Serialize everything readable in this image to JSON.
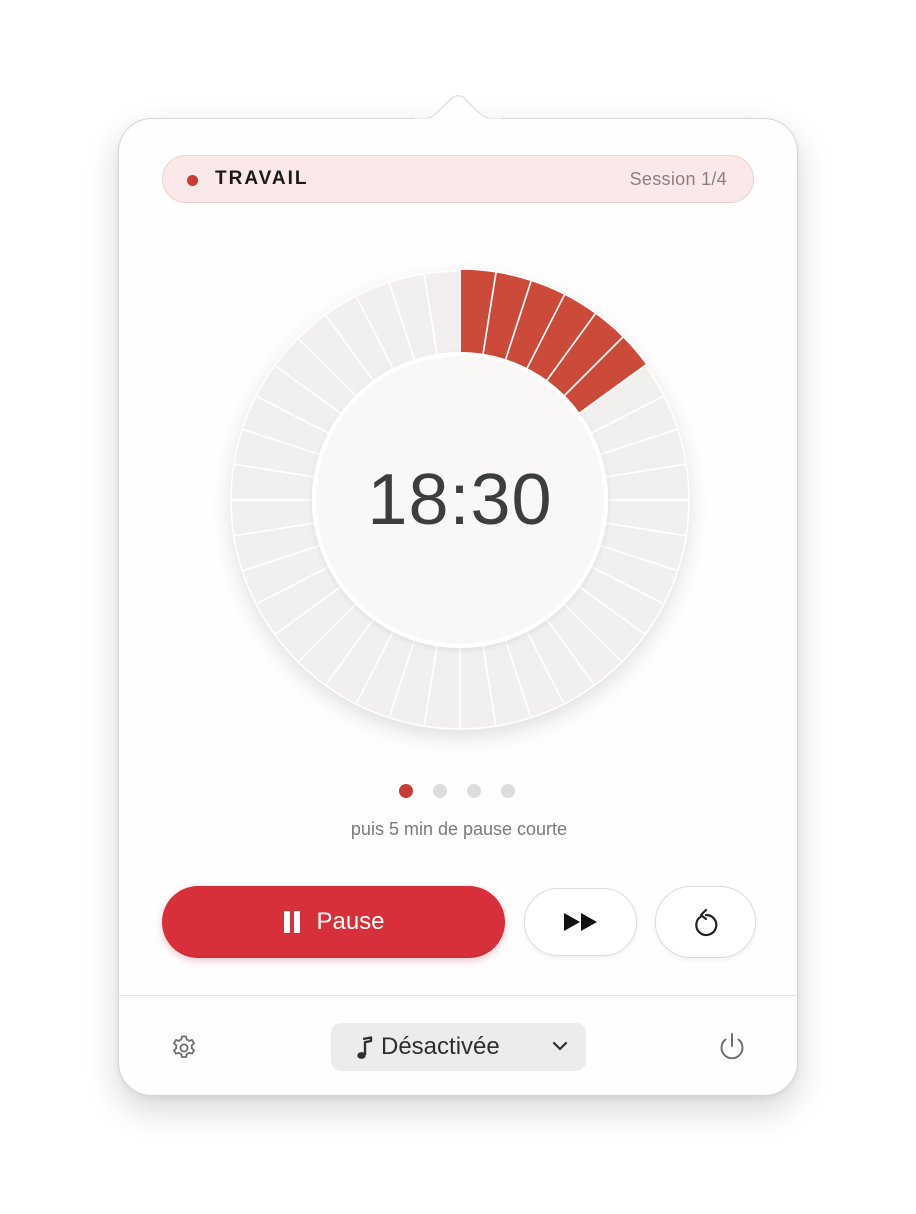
{
  "mode": {
    "label": "TRAVAIL",
    "session_label": "Session 1/4",
    "accent_color": "#c93b35"
  },
  "timer": {
    "display": "18:30",
    "total_segments": 40,
    "elapsed_segments": 6,
    "progress_color": "#cc4a3a",
    "track_color": "#f2f0ee"
  },
  "sessions": {
    "total": 4,
    "current_index": 0,
    "active_color": "#c93b35",
    "inactive_color": "#dddddd"
  },
  "next_break_text": "puis 5 min de pause courte",
  "controls": {
    "pause_label": "Pause",
    "pause_color": "#d8303a",
    "skip_icon": "fast-forward-icon",
    "reset_icon": "restart-icon"
  },
  "footer": {
    "settings_icon": "gear-icon",
    "sound_icon": "music-note-icon",
    "sound_value": "Désactivée",
    "power_icon": "power-icon"
  }
}
